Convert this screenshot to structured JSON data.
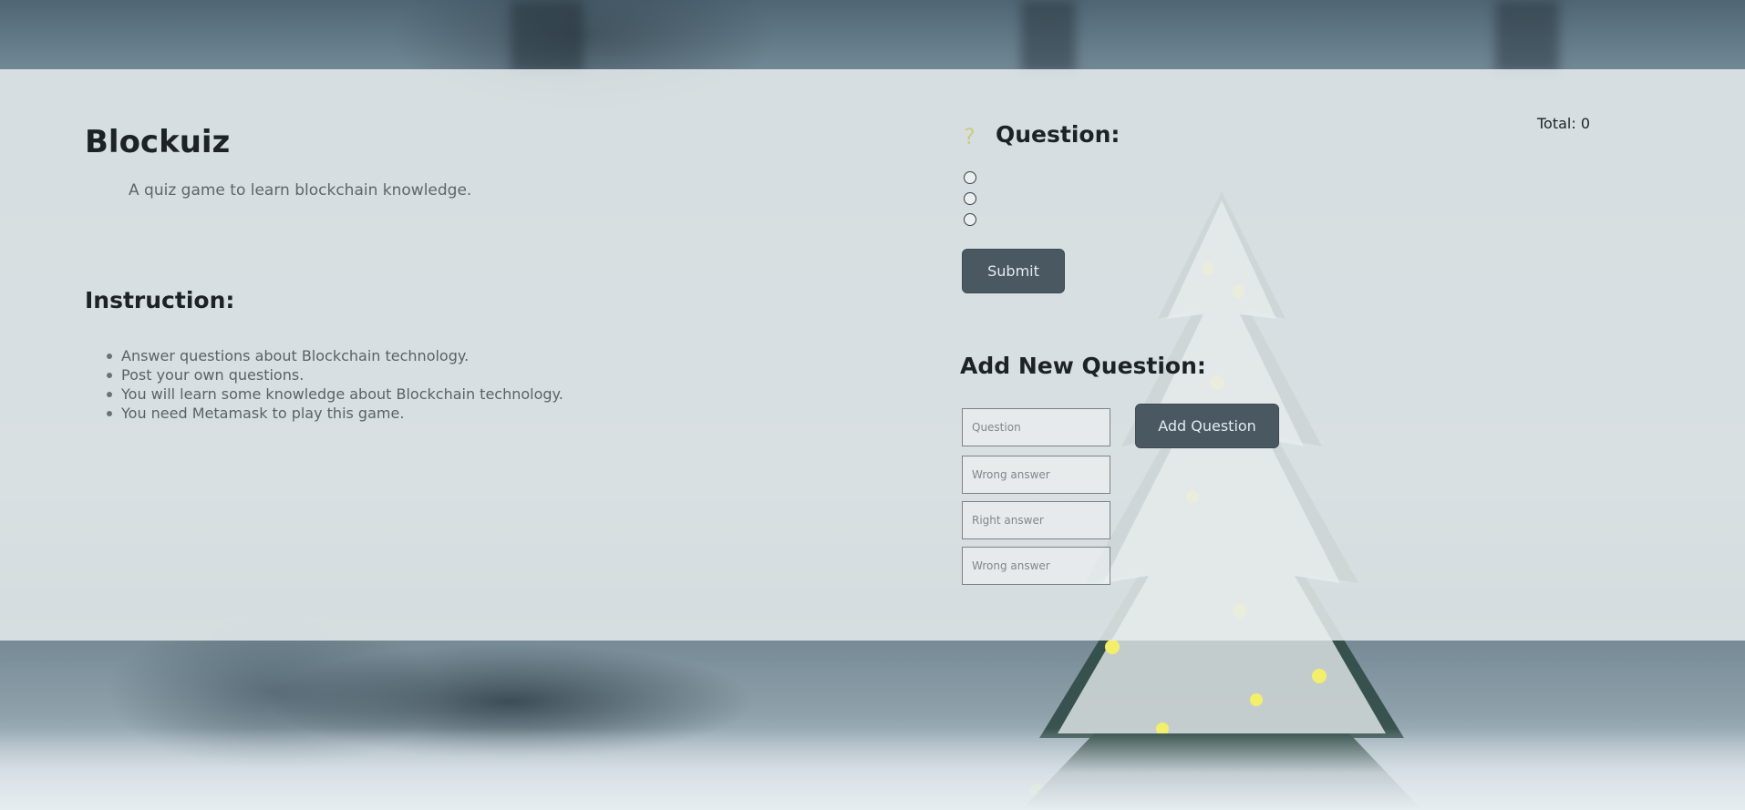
{
  "app": {
    "title": "Blockuiz",
    "subtitle": "A quiz game to learn blockchain knowledge."
  },
  "instruction": {
    "heading": "Instruction:",
    "items": [
      "Answer questions about Blockchain technology.",
      "Post your own questions.",
      "You will learn some knowledge about Blockchain technology.",
      "You need Metamask to play this game."
    ]
  },
  "quiz": {
    "icon": "question-icon",
    "icon_glyph": "?",
    "icon_color": "#c8cf7a",
    "heading": "Question:",
    "total_label": "Total: 0",
    "submit_label": "Submit"
  },
  "add_question": {
    "heading": "Add New Question:",
    "fields": {
      "question_placeholder": "Question",
      "wrong1_placeholder": "Wrong answer",
      "right_placeholder": "Right answer",
      "wrong2_placeholder": "Wrong answer"
    },
    "button_label": "Add Question"
  },
  "colors": {
    "button_bg": "#4a5862",
    "panel_bg": "rgba(232,236,238,0.86)"
  }
}
